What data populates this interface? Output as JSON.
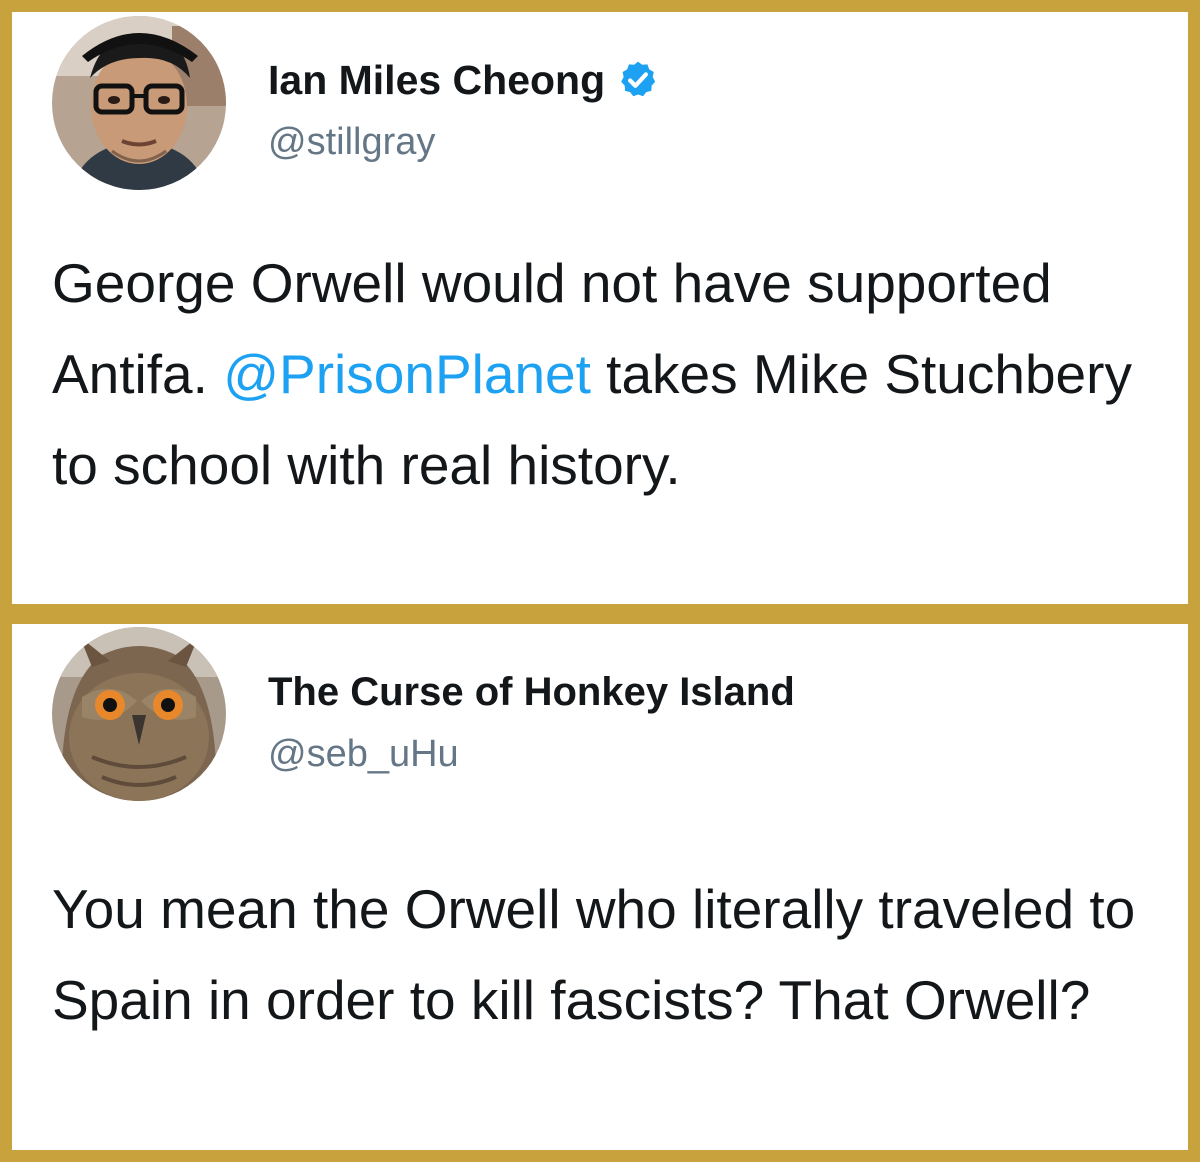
{
  "tweets": [
    {
      "author": {
        "name": "Ian Miles Cheong",
        "handle": "@stillgray",
        "verified": true,
        "avatar_icon": "man-with-glasses-avatar"
      },
      "text": {
        "before": "George Orwell would not have supported Antifa. ",
        "mention": "@PrisonPlanet",
        "after": " takes Mike Stuchbery to school with real history."
      }
    },
    {
      "author": {
        "name": "The Curse of Honkey Island",
        "handle": "@seb_uHu",
        "verified": false,
        "avatar_icon": "owl-avatar"
      },
      "text": {
        "before": "You mean the Orwell who literally traveled to Spain in order to kill fascists? That Orwell?",
        "mention": "",
        "after": ""
      }
    }
  ],
  "colors": {
    "frame": "#c8a23c",
    "panel": "#ffffff",
    "text": "#14171a",
    "handle": "#657786",
    "mention": "#1da1f2",
    "verified_badge": "#1da1f2"
  }
}
